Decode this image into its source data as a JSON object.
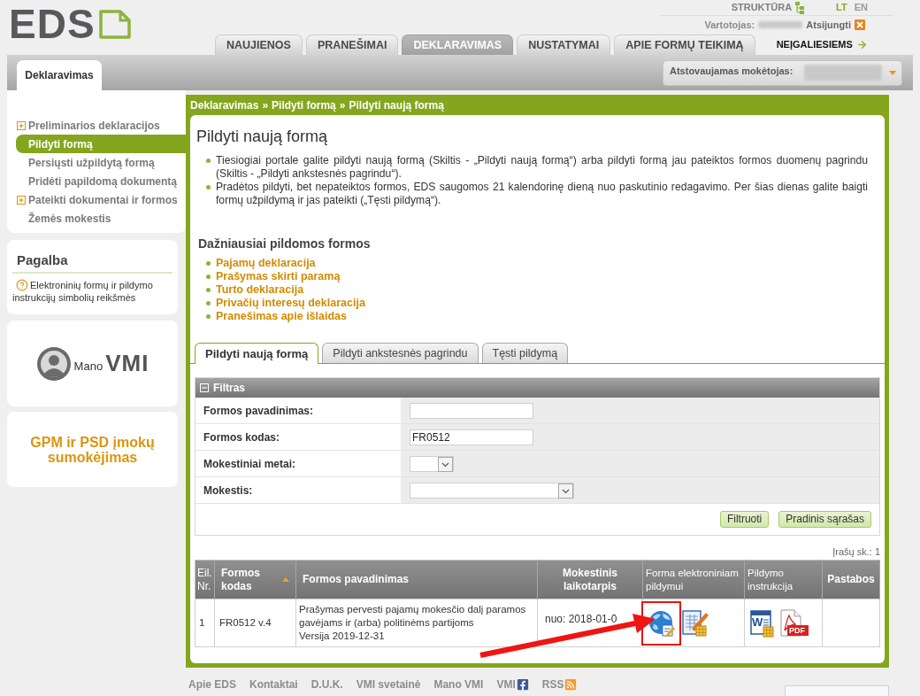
{
  "header": {
    "logo": "EDS",
    "structure_link": "STRUKTŪRA",
    "languages": [
      {
        "label": "LT",
        "selected": true
      },
      {
        "label": "EN",
        "selected": false
      }
    ],
    "user_label": "Vartotojas:",
    "logout": "Atsijungti"
  },
  "nav": {
    "tabs": [
      {
        "label": "NAUJIENOS",
        "selected": false
      },
      {
        "label": "PRANEŠIMAI",
        "selected": false
      },
      {
        "label": "DEKLARAVIMAS",
        "selected": true
      },
      {
        "label": "NUSTATYMAI",
        "selected": false
      },
      {
        "label": "APIE FORMŲ TEIKIMĄ",
        "selected": false
      }
    ],
    "accessibility_link": "NEĮGALIESIEMS"
  },
  "subheader": {
    "section_tab": "Deklaravimas",
    "payer_label": "Atstovaujamas mokėtojas:"
  },
  "sidebar": {
    "items": [
      {
        "label": "Preliminarios deklaracijos",
        "selected": false,
        "expanded": false
      },
      {
        "label": "Pildyti formą",
        "selected": true
      },
      {
        "label": "Persiųsti užpildytą formą",
        "selected": false
      },
      {
        "label": "Pridėti papildomą dokumentą",
        "selected": false
      },
      {
        "label": "Pateikti dokumentai ir formos",
        "selected": false,
        "expanded": false
      },
      {
        "label": "Žemės mokestis",
        "selected": false
      }
    ]
  },
  "help": {
    "title": "Pagalba",
    "link": "Elektroninių formų ir pildymo instrukcijų simbolių reikšmės"
  },
  "banners": [
    {
      "kind": "logo",
      "small": "Mano",
      "large": "VMI"
    },
    {
      "kind": "text",
      "text": "GPM ir PSD įmokų sumokėjimas"
    }
  ],
  "breadcrumb": {
    "separator": "»",
    "items": [
      "Deklaravimas",
      "Pildyti formą",
      "Pildyti naują formą"
    ]
  },
  "page_title": "Pildyti naują formą",
  "intro": [
    "Tiesiogiai portale galite pildyti naują formą (Skiltis - „Pildyti naują formą“) arba pildyti formą jau pateiktos formos duomenų pagrindu (Skiltis - „Pildyti ankstesnės pagrindu“).",
    "Pradėtos pildyti, bet nepateiktos formos, EDS saugomos 21 kalendorinę dieną nuo paskutinio redagavimo. Per šias dienas galite baigti formų užpildymą ir jas pateikti („Tęsti pildymą“)."
  ],
  "frequent_forms": {
    "title": "Dažniausiai pildomos formos",
    "links": [
      "Pajamų deklaracija",
      "Prašymas skirti paramą",
      "Turto deklaracija",
      "Privačių interesų deklaracija",
      "Pranešimas apie išlaidas"
    ]
  },
  "form_tabs": [
    {
      "label": "Pildyti naują formą",
      "selected": true
    },
    {
      "label": "Pildyti ankstesnės pagrindu",
      "selected": false
    },
    {
      "label": "Tęsti pildymą",
      "selected": false
    }
  ],
  "filter": {
    "title": "Filtras",
    "expanded": true,
    "fields": [
      {
        "kind": "text",
        "label": "Formos pavadinimas:"
      },
      {
        "kind": "text",
        "label": "Formos kodas:",
        "value": "FR0512"
      },
      {
        "kind": "short_select",
        "label": "Mokestiniai metai:"
      },
      {
        "kind": "select",
        "label": "Mokestis:"
      }
    ],
    "buttons": [
      "Filtruoti",
      "Pradinis sąrašas"
    ]
  },
  "record_count": "Įrašų sk.: 1",
  "table": {
    "columns": [
      {
        "label": "Eil. Nr.",
        "kind": "index",
        "sorted": false
      },
      {
        "label": "Formos kodas",
        "kind": "text",
        "sorted": true
      },
      {
        "label": "Formos pavadinimas",
        "kind": "text",
        "sorted": false
      },
      {
        "label": "Mokestinis laikotarpis",
        "kind": "text",
        "sorted": false
      },
      {
        "label": "Forma elektroniniam pildymui",
        "kind": "icons",
        "sorted": false
      },
      {
        "label": "Pildymo instrukcija",
        "kind": "icons",
        "sorted": false
      },
      {
        "label": "Pastabos",
        "kind": "text",
        "sorted": false
      }
    ],
    "rows": [
      {
        "number": "1",
        "code": "FR0512 v.4",
        "name": "Prašymas pervesti pajamų mokesčio dalį paramos gavėjams ir (arba) politinėms partijoms",
        "version": "Versija 2019-12-31",
        "period": "nuo: 2018-01-0",
        "annotated": true,
        "instruction_files": [
          {
            "kind": "word",
            "tag": "W"
          },
          {
            "kind": "pdf",
            "tag": "PDF"
          }
        ]
      }
    ]
  },
  "footer": {
    "links": [
      {
        "label": "Apie EDS",
        "kind": "plain"
      },
      {
        "label": "Kontaktai",
        "kind": "plain"
      },
      {
        "label": "D.U.K.",
        "kind": "plain"
      },
      {
        "label": "VMI svetainė",
        "kind": "plain"
      },
      {
        "label": "Mano VMI",
        "kind": "plain"
      },
      {
        "label": "VMI",
        "kind": "social"
      },
      {
        "label": "RSS",
        "kind": "feed"
      }
    ]
  }
}
